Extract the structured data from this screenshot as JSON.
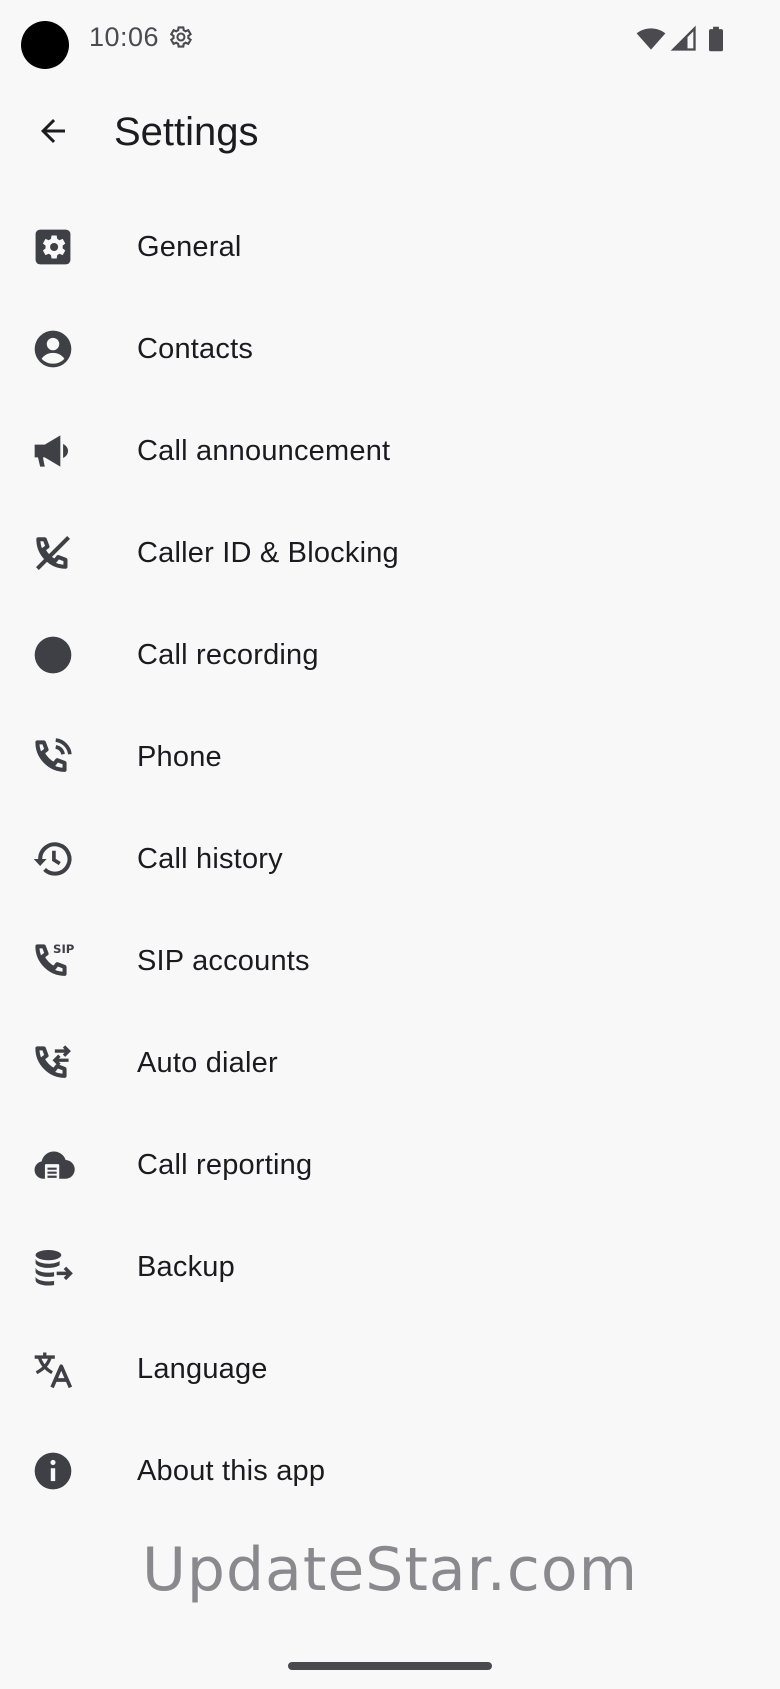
{
  "status_bar": {
    "time": "10:06",
    "icons": [
      "settings-gear-icon",
      "wifi-icon",
      "cellular-signal-icon",
      "battery-icon"
    ]
  },
  "app_bar": {
    "title": "Settings",
    "back_icon": "arrow-back-icon"
  },
  "settings_items": [
    {
      "label": "General",
      "icon": "gear-icon"
    },
    {
      "label": "Contacts",
      "icon": "account-circle-icon"
    },
    {
      "label": "Call announcement",
      "icon": "megaphone-icon"
    },
    {
      "label": "Caller ID & Blocking",
      "icon": "phone-blocked-icon"
    },
    {
      "label": "Call recording",
      "icon": "record-dot-icon"
    },
    {
      "label": "Phone",
      "icon": "phone-in-talk-icon"
    },
    {
      "label": "Call history",
      "icon": "history-icon"
    },
    {
      "label": "SIP accounts",
      "icon": "sip-phone-icon"
    },
    {
      "label": "Auto dialer",
      "icon": "phone-forwarded-icon"
    },
    {
      "label": "Call reporting",
      "icon": "cloud-report-icon"
    },
    {
      "label": "Backup",
      "icon": "database-export-icon"
    },
    {
      "label": "Language",
      "icon": "translate-icon"
    },
    {
      "label": "About this app",
      "icon": "info-icon"
    }
  ],
  "watermark": "UpdateStar.com",
  "colors": {
    "background": "#f8f8f9",
    "icon": "#3f3f46",
    "text": "#1b1b1f"
  }
}
